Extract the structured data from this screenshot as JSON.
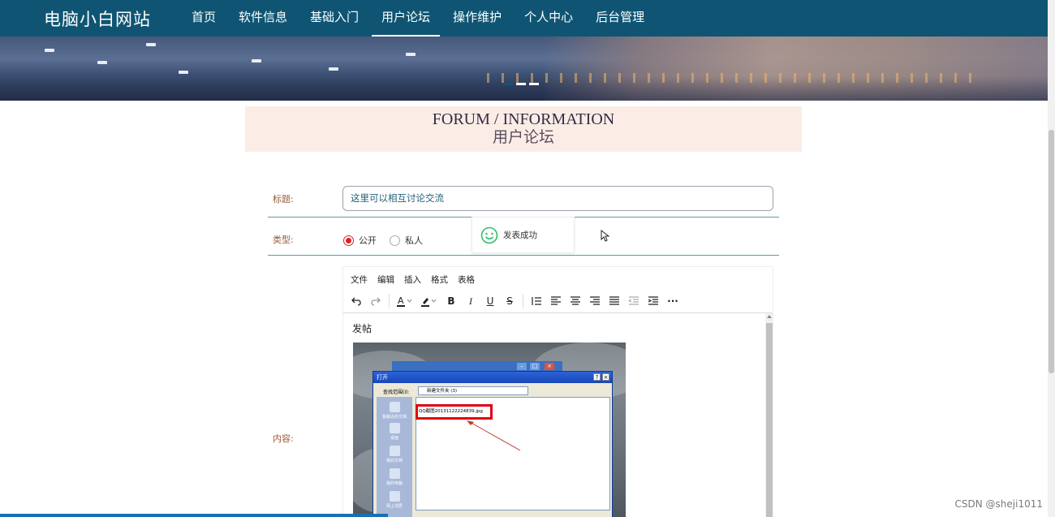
{
  "nav": {
    "brand": "电脑小白网站",
    "items": [
      {
        "label": "首页",
        "active": false
      },
      {
        "label": "软件信息",
        "active": false
      },
      {
        "label": "基础入门",
        "active": false
      },
      {
        "label": "用户论坛",
        "active": true
      },
      {
        "label": "操作维护",
        "active": false
      },
      {
        "label": "个人中心",
        "active": false
      },
      {
        "label": "后台管理",
        "active": false
      }
    ]
  },
  "colors": {
    "nav_bg": "#0f5573",
    "header_bg": "#fbede6",
    "label": "#9a5a37",
    "radio_on": "#dd2222"
  },
  "section": {
    "title_en": "FORUM / INFORMATION",
    "title_cn": "用户论坛"
  },
  "form": {
    "title_label": "标题:",
    "title_value": "这里可以相互讨论交流",
    "type_label": "类型:",
    "type_options": [
      {
        "label": "公开",
        "checked": true
      },
      {
        "label": "私人",
        "checked": false
      }
    ],
    "content_label": "内容:"
  },
  "toast": {
    "text": "发表成功",
    "icon": "smile-icon"
  },
  "editor": {
    "menus": [
      "文件",
      "编辑",
      "插入",
      "格式",
      "表格"
    ],
    "toolbar": [
      "undo-icon",
      "redo-icon",
      "text-color-icon",
      "highlight-icon",
      "bold-icon",
      "italic-icon",
      "underline-icon",
      "strikethrough-icon",
      "line-height-icon",
      "align-left-icon",
      "align-center-icon",
      "align-right-icon",
      "align-justify-icon",
      "outdent-icon",
      "indent-icon",
      "more-icon"
    ],
    "body_text": "发帖",
    "image": {
      "dialog_title": "打开",
      "look_in_label": "查找范围(I):",
      "folder": "新建文件夹 (3)",
      "file": "QQ截图20131122224839.jpg",
      "places": [
        "我最近的文档",
        "桌面",
        "我的文档",
        "我的电脑",
        "网上邻居"
      ]
    }
  },
  "watermark": "CSDN @sheji1011"
}
